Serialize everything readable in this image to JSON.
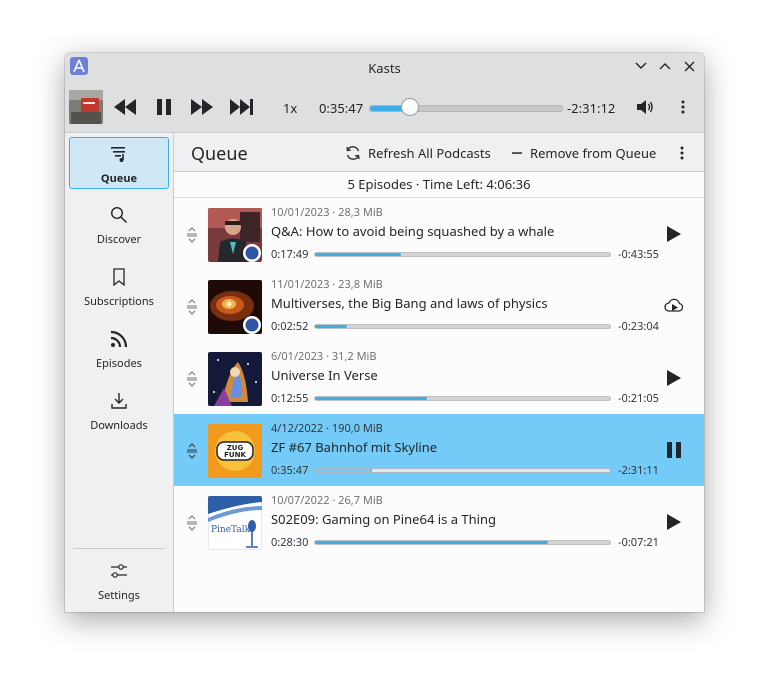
{
  "window": {
    "title": "Kasts"
  },
  "player": {
    "rate": "1x",
    "position": "0:35:47",
    "remaining": "-2:31:12",
    "progress": 0.21
  },
  "sidebar": {
    "items": [
      {
        "label": "Queue",
        "icon": "queue-icon",
        "active": true
      },
      {
        "label": "Discover",
        "icon": "search-icon",
        "active": false
      },
      {
        "label": "Subscriptions",
        "icon": "bookmark-icon",
        "active": false
      },
      {
        "label": "Episodes",
        "icon": "rss-icon",
        "active": false
      },
      {
        "label": "Downloads",
        "icon": "download-icon",
        "active": false
      }
    ],
    "settings_label": "Settings"
  },
  "header": {
    "title": "Queue",
    "refresh_label": "Refresh All Podcasts",
    "remove_label": "Remove from Queue"
  },
  "summary": "5 Episodes  ·  Time Left: 4:06:36",
  "episodes": [
    {
      "meta": "10/01/2023  ·  28,3 MiB",
      "title": "Q&A: How to avoid being squashed by a whale",
      "position": "0:17:49",
      "remaining": "-0:43:55",
      "progress": 0.29,
      "action": "play",
      "selected": false
    },
    {
      "meta": "11/01/2023  ·  23,8 MiB",
      "title": "Multiverses, the Big Bang and laws of physics",
      "position": "0:02:52",
      "remaining": "-0:23:04",
      "progress": 0.11,
      "action": "stream",
      "selected": false
    },
    {
      "meta": "6/01/2023  ·  31,2 MiB",
      "title": "Universe In Verse",
      "position": "0:12:55",
      "remaining": "-0:21:05",
      "progress": 0.38,
      "action": "play",
      "selected": false
    },
    {
      "meta": "4/12/2022  ·  190,0 MiB",
      "title": "ZF #67 Bahnhof mit Skyline",
      "position": "0:35:47",
      "remaining": "-2:31:11",
      "progress": 0.19,
      "action": "pause",
      "selected": true
    },
    {
      "meta": "10/07/2022  ·  26,7 MiB",
      "title": "S02E09: Gaming on Pine64 is a Thing",
      "position": "0:28:30",
      "remaining": "-0:07:21",
      "progress": 0.79,
      "action": "play",
      "selected": false
    }
  ],
  "thumb_text": {
    "zf": "ZUG FUNK",
    "pinetalk": "PineTalk"
  },
  "colors": {
    "accent": "#3daee9",
    "selected_row": "#75cbf7"
  }
}
